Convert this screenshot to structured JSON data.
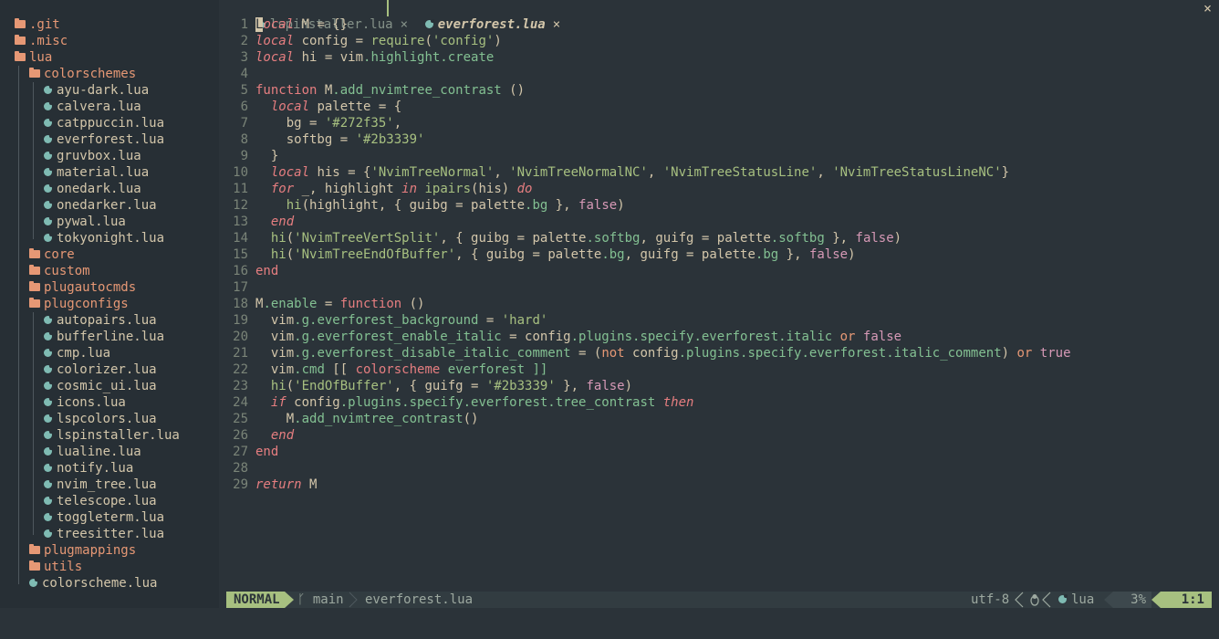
{
  "tree": {
    "items": [
      {
        "label": ".git",
        "kind": "folder",
        "depth": 0
      },
      {
        "label": ".misc",
        "kind": "folder",
        "depth": 0
      },
      {
        "label": "lua",
        "kind": "folder",
        "depth": 0
      },
      {
        "label": "colorschemes",
        "kind": "folder",
        "depth": 1
      },
      {
        "label": "ayu-dark.lua",
        "kind": "file",
        "depth": 2
      },
      {
        "label": "calvera.lua",
        "kind": "file",
        "depth": 2
      },
      {
        "label": "catppuccin.lua",
        "kind": "file",
        "depth": 2
      },
      {
        "label": "everforest.lua",
        "kind": "file",
        "depth": 2
      },
      {
        "label": "gruvbox.lua",
        "kind": "file",
        "depth": 2
      },
      {
        "label": "material.lua",
        "kind": "file",
        "depth": 2
      },
      {
        "label": "onedark.lua",
        "kind": "file",
        "depth": 2
      },
      {
        "label": "onedarker.lua",
        "kind": "file",
        "depth": 2
      },
      {
        "label": "pywal.lua",
        "kind": "file",
        "depth": 2
      },
      {
        "label": "tokyonight.lua",
        "kind": "file",
        "depth": 2
      },
      {
        "label": "core",
        "kind": "folder",
        "depth": 1
      },
      {
        "label": "custom",
        "kind": "folder",
        "depth": 1
      },
      {
        "label": "plugautocmds",
        "kind": "folder",
        "depth": 1
      },
      {
        "label": "plugconfigs",
        "kind": "folder",
        "depth": 1
      },
      {
        "label": "autopairs.lua",
        "kind": "file",
        "depth": 2
      },
      {
        "label": "bufferline.lua",
        "kind": "file",
        "depth": 2
      },
      {
        "label": "cmp.lua",
        "kind": "file",
        "depth": 2
      },
      {
        "label": "colorizer.lua",
        "kind": "file",
        "depth": 2
      },
      {
        "label": "cosmic_ui.lua",
        "kind": "file",
        "depth": 2
      },
      {
        "label": "icons.lua",
        "kind": "file",
        "depth": 2
      },
      {
        "label": "lspcolors.lua",
        "kind": "file",
        "depth": 2
      },
      {
        "label": "lspinstaller.lua",
        "kind": "file",
        "depth": 2
      },
      {
        "label": "lualine.lua",
        "kind": "file",
        "depth": 2
      },
      {
        "label": "notify.lua",
        "kind": "file",
        "depth": 2
      },
      {
        "label": "nvim_tree.lua",
        "kind": "file",
        "depth": 2
      },
      {
        "label": "telescope.lua",
        "kind": "file",
        "depth": 2
      },
      {
        "label": "toggleterm.lua",
        "kind": "file",
        "depth": 2
      },
      {
        "label": "treesitter.lua",
        "kind": "file",
        "depth": 2
      },
      {
        "label": "plugmappings",
        "kind": "folder",
        "depth": 1
      },
      {
        "label": "utils",
        "kind": "folder",
        "depth": 1
      },
      {
        "label": "colorscheme.lua",
        "kind": "file",
        "depth": 1
      }
    ]
  },
  "tabs": [
    {
      "label": "lspinstaller.lua",
      "active": false,
      "close": "×"
    },
    {
      "label": "everforest.lua",
      "active": true,
      "close": "×"
    }
  ],
  "window_close": "×",
  "editor": {
    "lines": [
      [
        [
          "L",
          "cursor"
        ],
        [
          "ocal",
          "kw"
        ],
        [
          " M = {}",
          "pl"
        ]
      ],
      [
        [
          "local",
          "kw"
        ],
        [
          " config = ",
          "pl"
        ],
        [
          "require",
          "fn"
        ],
        [
          "(",
          "pl"
        ],
        [
          "'config'",
          "str"
        ],
        [
          ")",
          "pl"
        ]
      ],
      [
        [
          "local",
          "kw"
        ],
        [
          " hi = vim",
          "pl"
        ],
        [
          ".highlight.create",
          "fld"
        ]
      ],
      [],
      [
        [
          "function",
          "kwn"
        ],
        [
          " M",
          "pl"
        ],
        [
          ".add_nvimtree_contrast",
          "fld"
        ],
        [
          " ()",
          "pl"
        ]
      ],
      [
        [
          "  ",
          "pl"
        ],
        [
          "local",
          "kw"
        ],
        [
          " palette = {",
          "pl"
        ]
      ],
      [
        [
          "    bg = ",
          "pl"
        ],
        [
          "'#272f35'",
          "str"
        ],
        [
          ",",
          "pl"
        ]
      ],
      [
        [
          "    softbg = ",
          "pl"
        ],
        [
          "'#2b3339'",
          "str"
        ]
      ],
      [
        [
          "  }",
          "pl"
        ]
      ],
      [
        [
          "  ",
          "pl"
        ],
        [
          "local",
          "kw"
        ],
        [
          " his = {",
          "pl"
        ],
        [
          "'NvimTreeNormal'",
          "str"
        ],
        [
          ", ",
          "pl"
        ],
        [
          "'NvimTreeNormalNC'",
          "str"
        ],
        [
          ", ",
          "pl"
        ],
        [
          "'NvimTreeStatusLine'",
          "str"
        ],
        [
          ", ",
          "pl"
        ],
        [
          "'NvimTreeStatusLineNC'",
          "str"
        ],
        [
          "}",
          "pl"
        ]
      ],
      [
        [
          "  ",
          "pl"
        ],
        [
          "for",
          "kw"
        ],
        [
          " _, highlight ",
          "pl"
        ],
        [
          "in",
          "kw"
        ],
        [
          " ",
          "pl"
        ],
        [
          "ipairs",
          "fn"
        ],
        [
          "(his) ",
          "pl"
        ],
        [
          "do",
          "kw"
        ]
      ],
      [
        [
          "    ",
          "pl"
        ],
        [
          "hi",
          "fn"
        ],
        [
          "(highlight, { guibg = palette",
          "pl"
        ],
        [
          ".bg",
          "fld"
        ],
        [
          " }, ",
          "pl"
        ],
        [
          "false",
          "pu"
        ],
        [
          ")",
          "pl"
        ]
      ],
      [
        [
          "  ",
          "pl"
        ],
        [
          "end",
          "kw"
        ]
      ],
      [
        [
          "  ",
          "pl"
        ],
        [
          "hi",
          "fn"
        ],
        [
          "(",
          "pl"
        ],
        [
          "'NvimTreeVertSplit'",
          "str"
        ],
        [
          ", { guibg = palette",
          "pl"
        ],
        [
          ".softbg",
          "fld"
        ],
        [
          ", guifg = palette",
          "pl"
        ],
        [
          ".softbg",
          "fld"
        ],
        [
          " }, ",
          "pl"
        ],
        [
          "false",
          "pu"
        ],
        [
          ")",
          "pl"
        ]
      ],
      [
        [
          "  ",
          "pl"
        ],
        [
          "hi",
          "fn"
        ],
        [
          "(",
          "pl"
        ],
        [
          "'NvimTreeEndOfBuffer'",
          "str"
        ],
        [
          ", { guibg = palette",
          "pl"
        ],
        [
          ".bg",
          "fld"
        ],
        [
          ", guifg = palette",
          "pl"
        ],
        [
          ".bg",
          "fld"
        ],
        [
          " }, ",
          "pl"
        ],
        [
          "false",
          "pu"
        ],
        [
          ")",
          "pl"
        ]
      ],
      [
        [
          "end",
          "kwn"
        ]
      ],
      [],
      [
        [
          "M",
          "pl"
        ],
        [
          ".enable",
          "fld"
        ],
        [
          " = ",
          "pl"
        ],
        [
          "function",
          "kwn"
        ],
        [
          " ()",
          "pl"
        ]
      ],
      [
        [
          "  vim",
          "pl"
        ],
        [
          ".g.everforest_background",
          "fld"
        ],
        [
          " = ",
          "pl"
        ],
        [
          "'hard'",
          "str"
        ]
      ],
      [
        [
          "  vim",
          "pl"
        ],
        [
          ".g.everforest_enable_italic",
          "fld"
        ],
        [
          " = config",
          "pl"
        ],
        [
          ".plugins.specify.everforest.italic",
          "fld"
        ],
        [
          " ",
          "pl"
        ],
        [
          "or",
          "op"
        ],
        [
          " ",
          "pl"
        ],
        [
          "false",
          "pu"
        ]
      ],
      [
        [
          "  vim",
          "pl"
        ],
        [
          ".g.everforest_disable_italic_comment",
          "fld"
        ],
        [
          " = (",
          "pl"
        ],
        [
          "not",
          "op"
        ],
        [
          " config",
          "pl"
        ],
        [
          ".plugins.specify.everforest.italic_comment",
          "fld"
        ],
        [
          ") ",
          "pl"
        ],
        [
          "or",
          "op"
        ],
        [
          " ",
          "pl"
        ],
        [
          "true",
          "pu"
        ]
      ],
      [
        [
          "  vim",
          "pl"
        ],
        [
          ".cmd",
          "fld"
        ],
        [
          " [[ ",
          "pl"
        ],
        [
          "colorscheme",
          "kwn"
        ],
        [
          " everforest ]]",
          "fld"
        ]
      ],
      [
        [
          "  ",
          "pl"
        ],
        [
          "hi",
          "fn"
        ],
        [
          "(",
          "pl"
        ],
        [
          "'EndOfBuffer'",
          "str"
        ],
        [
          ", { guifg = ",
          "pl"
        ],
        [
          "'#2b3339'",
          "str"
        ],
        [
          " }, ",
          "pl"
        ],
        [
          "false",
          "pu"
        ],
        [
          ")",
          "pl"
        ]
      ],
      [
        [
          "  ",
          "pl"
        ],
        [
          "if",
          "kw"
        ],
        [
          " config",
          "pl"
        ],
        [
          ".plugins.specify.everforest.tree_contrast",
          "fld"
        ],
        [
          " ",
          "pl"
        ],
        [
          "then",
          "kw"
        ]
      ],
      [
        [
          "    M",
          "pl"
        ],
        [
          ".add_nvimtree_contrast",
          "fld"
        ],
        [
          "()",
          "pl"
        ]
      ],
      [
        [
          "  ",
          "pl"
        ],
        [
          "end",
          "kw"
        ]
      ],
      [
        [
          "end",
          "kwn"
        ]
      ],
      [],
      [
        [
          "return",
          "kw"
        ],
        [
          " M",
          "pl"
        ]
      ]
    ]
  },
  "statusline": {
    "mode": "NORMAL",
    "branch_icon": "ᚴ",
    "branch": "main",
    "filename": "everforest.lua",
    "encoding": "utf-8",
    "fileformat_icon": "penguin-icon",
    "filetype": "lua",
    "progress": "3%",
    "location": "1:1"
  },
  "colors": {
    "bg": "#2b3339",
    "tree_bg": "#272f35",
    "accent": "#a7c080",
    "red": "#e67e80",
    "orange": "#e69875",
    "aqua": "#83c092",
    "blue": "#7fbbb3"
  }
}
